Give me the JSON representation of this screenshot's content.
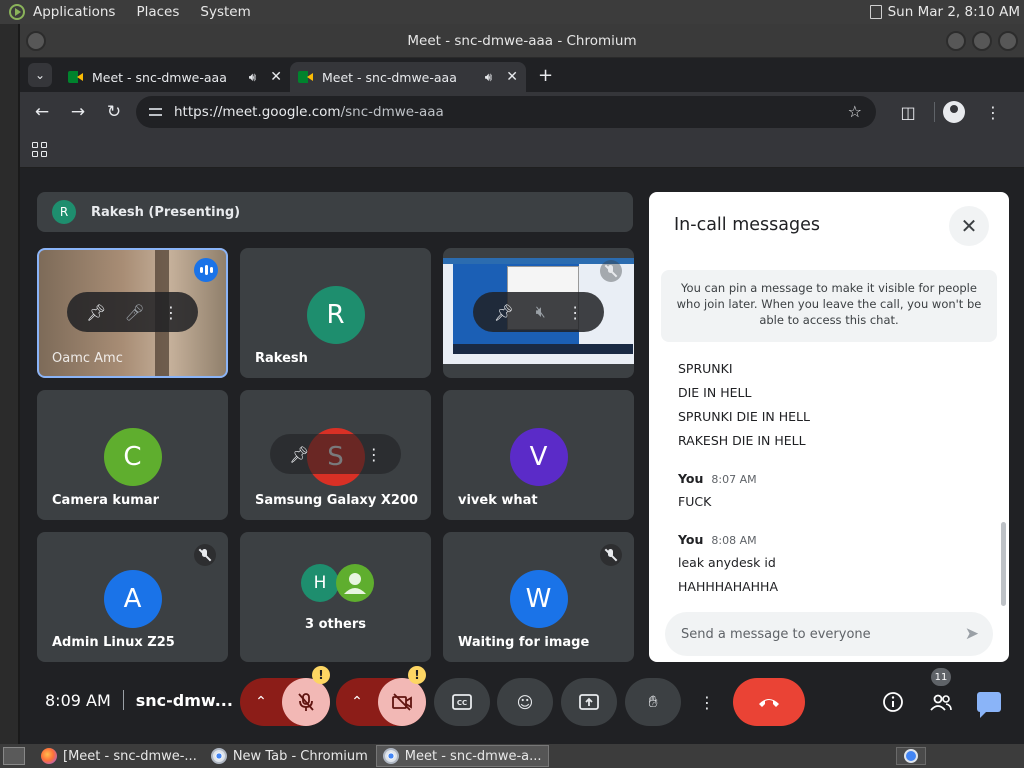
{
  "system_bar": {
    "menus": [
      "Applications",
      "Places",
      "System"
    ],
    "clock": "Sun Mar  2,  8:10 AM"
  },
  "window": {
    "title": "Meet - snc-dmwe-aaa - Chromium"
  },
  "tabs": [
    {
      "title": "Meet - snc-dmwe-aaa"
    },
    {
      "title": "Meet - snc-dmwe-aaa"
    }
  ],
  "omnibox": {
    "url_scheme_host": "https://meet.google.com",
    "url_path": "/snc-dmwe-aaa"
  },
  "presenting_bar": {
    "initial": "R",
    "label": "Rakesh (Presenting)"
  },
  "tiles": {
    "oamc": {
      "name": "Oamc Amc"
    },
    "rakesh": {
      "name": "Rakesh",
      "initial": "R",
      "color": "#1e8e6e"
    },
    "camera": {
      "name": "Camera kumar",
      "initial": "C",
      "color": "#5fae2e"
    },
    "samsung": {
      "name": "Samsung Galaxy X200",
      "initial": "S",
      "color": "#d93025"
    },
    "vivek": {
      "name": "vivek what",
      "initial": "V",
      "color": "#5b2bc8"
    },
    "admin": {
      "name": "Admin Linux Z25",
      "initial": "A",
      "color": "#1a73e8"
    },
    "others": {
      "label": "3 others",
      "initial_h": "H",
      "color_h": "#1e8e6e"
    },
    "waiting": {
      "name": "Waiting for image",
      "initial": "W",
      "color": "#1a73e8"
    }
  },
  "chat": {
    "title": "In-call messages",
    "pin_note": "You can pin a message to make it visible for people who join later. When you leave the call, you won't be able to access this chat.",
    "messages_block1": [
      "SPRUNKI",
      "DIE IN HELL",
      "SPRUNKI DIE IN HELL",
      "RAKESH DIE IN HELL"
    ],
    "group2": {
      "sender": "You",
      "time": "8:07 AM",
      "messages": [
        "FUCK"
      ]
    },
    "group3": {
      "sender": "You",
      "time": "8:08 AM",
      "messages": [
        "leak anydesk id",
        "HAHHHAHAHHA"
      ]
    },
    "compose_placeholder": "Send a message to everyone"
  },
  "call_bar": {
    "time": "8:09 AM",
    "meeting_code": "snc-dmw...",
    "warning_mark": "!",
    "people_count": "11"
  },
  "taskbar": {
    "tasks": [
      "[Meet - snc-dmwe-...",
      "New Tab - Chromium",
      "Meet - snc-dmwe-a..."
    ]
  },
  "colors": {
    "hangup": "#ea4335",
    "muted_bg": "#f2b8b5",
    "accent": "#8ab4f8"
  }
}
